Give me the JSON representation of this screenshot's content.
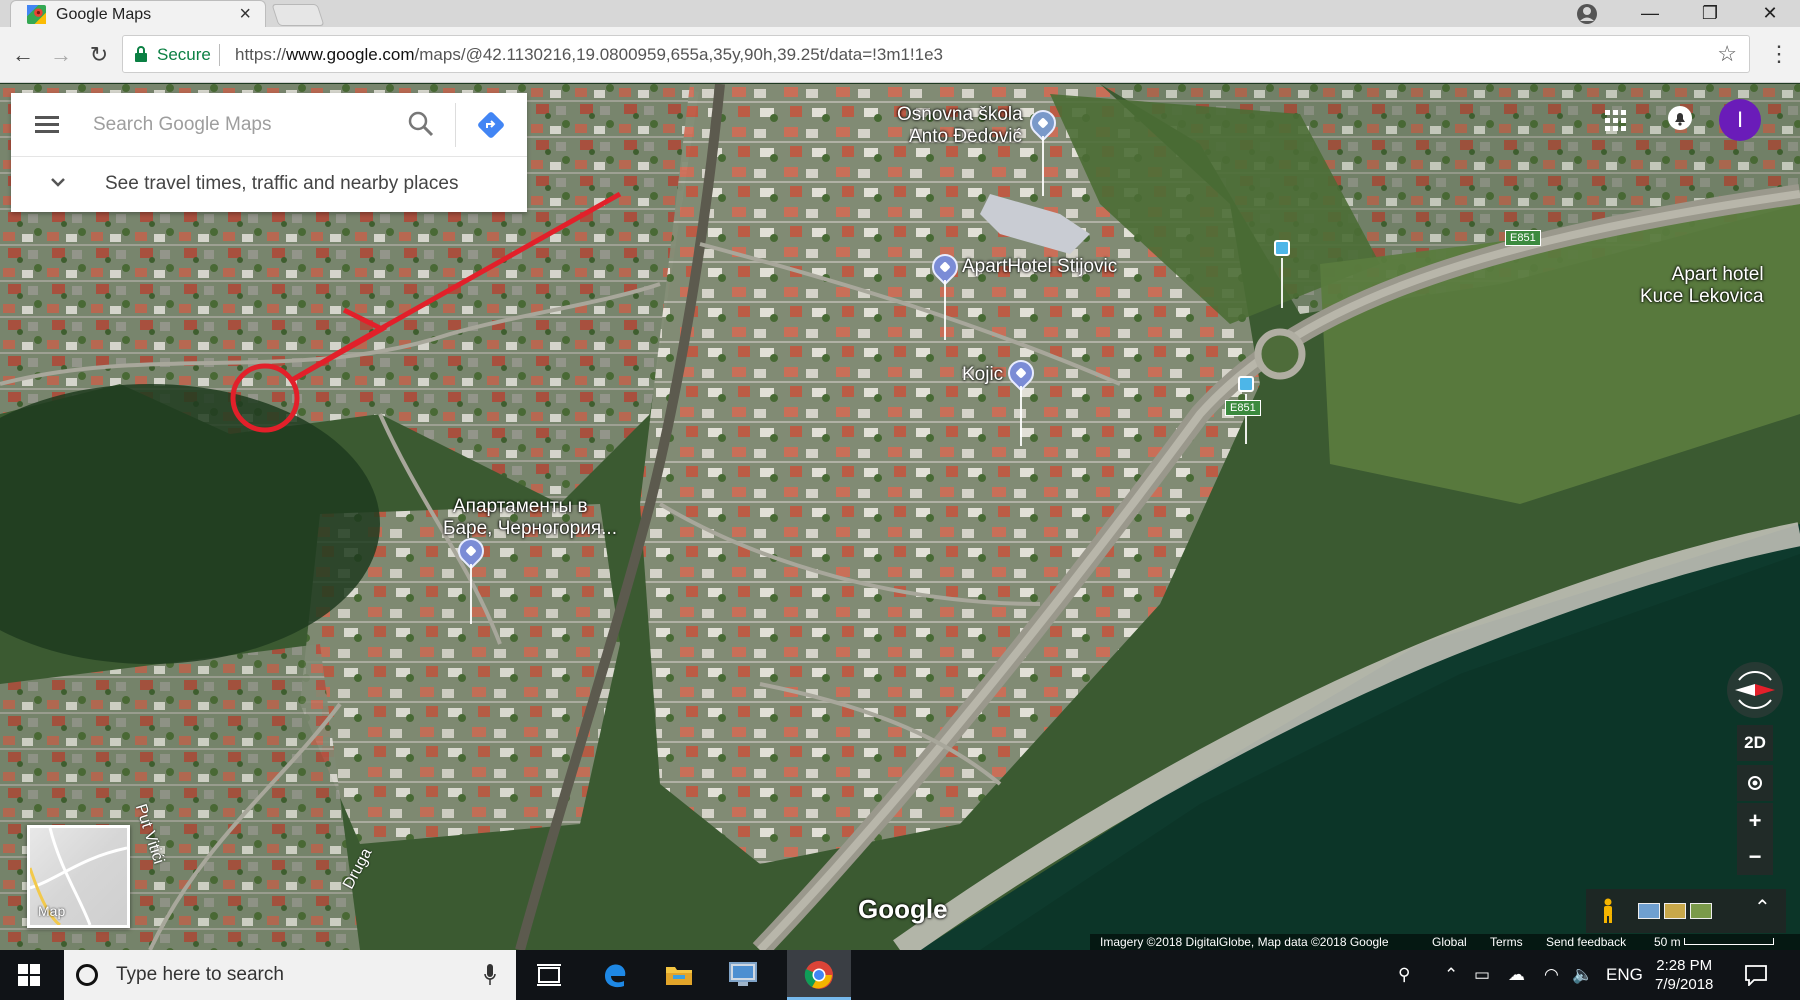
{
  "browser": {
    "tab_title": "Google Maps",
    "tab_close": "×",
    "secure_label": "Secure",
    "url_scheme": "https://",
    "url_host": "www.google.com",
    "url_path": "/maps/@42.1130216,19.0800959,655a,35y,90h,39.25t/data=!3m1!1e3",
    "window_controls": {
      "minimize": "—",
      "maximize": "❐",
      "close": "✕"
    },
    "nav": {
      "back": "←",
      "forward": "→",
      "reload": "↻"
    }
  },
  "search": {
    "placeholder": "Search Google Maps",
    "travel_link": "See travel times, traffic and nearby places"
  },
  "user": {
    "avatar_letter": "I"
  },
  "map": {
    "places": [
      {
        "line1": "Osnovna škola",
        "line2": "Anto Đedović"
      },
      {
        "line1": "ApartHotel Stijovic"
      },
      {
        "line1": "Kojic"
      },
      {
        "line1": "Apart hotel",
        "line2": "Kuce Lekovica"
      },
      {
        "line1": "Апартаменты в",
        "line2": "Баре, Черногория..."
      }
    ],
    "roads": {
      "put_vitici": "Put Vitići",
      "druga": "Druga"
    },
    "route_badge": "E851",
    "minimap_label": "Map",
    "logo": "Google",
    "controls": {
      "tilt": "2D",
      "zoom_in": "+",
      "zoom_out": "−",
      "expand": "⌃"
    },
    "attribution": {
      "imagery": "Imagery ©2018 DigitalGlobe, Map data ©2018 Google",
      "global": "Global",
      "terms": "Terms",
      "feedback": "Send feedback",
      "scale": "50 m"
    }
  },
  "taskbar": {
    "search_placeholder": "Type here to search",
    "language": "ENG",
    "time": "2:28 PM",
    "date": "7/9/2018"
  },
  "colors": {
    "accent_red": "#e2202a",
    "avatar": "#6a1cb9",
    "secure_green": "#0b8043"
  }
}
